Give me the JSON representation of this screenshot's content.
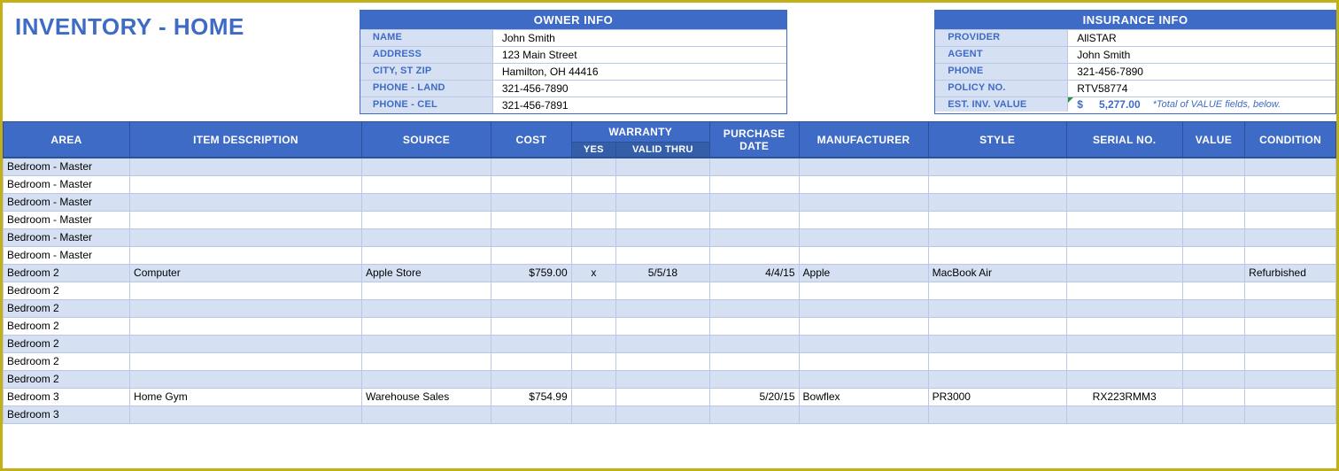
{
  "title": "INVENTORY - HOME",
  "owner": {
    "header": "OWNER INFO",
    "labels": [
      "NAME",
      "ADDRESS",
      "CITY, ST  ZIP",
      "PHONE - LAND",
      "PHONE - CEL"
    ],
    "values": [
      "John Smith",
      "123 Main Street",
      "Hamilton, OH  44416",
      "321-456-7890",
      "321-456-7891"
    ]
  },
  "insurance": {
    "header": "INSURANCE INFO",
    "labels": [
      "PROVIDER",
      "AGENT",
      "PHONE",
      "POLICY NO.",
      "EST. INV. VALUE"
    ],
    "values": [
      "AllSTAR",
      "John Smith",
      "321-456-7890",
      "RTV58774",
      ""
    ],
    "est_dollar": "$",
    "est_number": "5,277.00",
    "est_note": "*Total of VALUE fields, below."
  },
  "columns": {
    "area": "AREA",
    "desc": "ITEM DESCRIPTION",
    "source": "SOURCE",
    "cost": "COST",
    "warranty": "WARRANTY",
    "wyes": "YES",
    "wthru": "VALID THRU",
    "pdate": "PURCHASE DATE",
    "mfr": "MANUFACTURER",
    "style": "STYLE",
    "serial": "SERIAL NO.",
    "value": "VALUE",
    "cond": "CONDITION"
  },
  "rows": [
    {
      "area": "Bedroom - Master"
    },
    {
      "area": "Bedroom - Master"
    },
    {
      "area": "Bedroom - Master"
    },
    {
      "area": "Bedroom - Master"
    },
    {
      "area": "Bedroom - Master"
    },
    {
      "area": "Bedroom - Master"
    },
    {
      "area": "Bedroom 2",
      "desc": "Computer",
      "source": "Apple Store",
      "cost": "$759.00",
      "wyes": "x",
      "wthru": "5/5/18",
      "pdate": "4/4/15",
      "mfr": "Apple",
      "style": "MacBook Air",
      "serial": "",
      "value": "",
      "cond": "Refurbished"
    },
    {
      "area": "Bedroom 2"
    },
    {
      "area": "Bedroom 2"
    },
    {
      "area": "Bedroom 2"
    },
    {
      "area": "Bedroom 2"
    },
    {
      "area": "Bedroom 2"
    },
    {
      "area": "Bedroom 2"
    },
    {
      "area": "Bedroom 3",
      "desc": "Home Gym",
      "source": "Warehouse Sales",
      "cost": "$754.99",
      "wyes": "",
      "wthru": "",
      "pdate": "5/20/15",
      "mfr": "Bowflex",
      "style": "PR3000",
      "serial": "RX223RMM3",
      "value": "",
      "cond": ""
    },
    {
      "area": "Bedroom 3"
    }
  ]
}
